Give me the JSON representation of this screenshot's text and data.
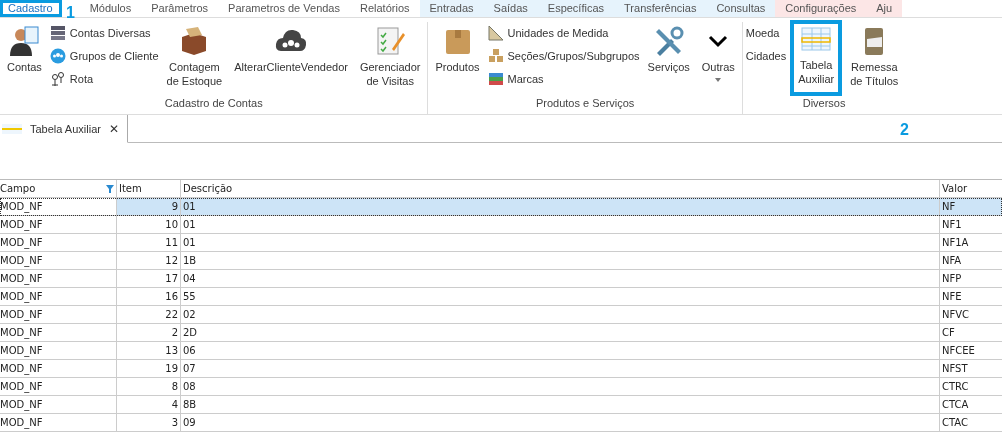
{
  "menu": [
    {
      "label": "Cadastro",
      "selected": true
    },
    {
      "label": "Módulos",
      "selected": false
    },
    {
      "label": "Parâmetros",
      "selected": false
    },
    {
      "label": "Parametros de Vendas",
      "selected": false
    },
    {
      "label": "Relatórios",
      "selected": false
    },
    {
      "label": "Entradas",
      "selected": false,
      "color": "#e6f3fc"
    },
    {
      "label": "Saídas",
      "selected": false,
      "color": "#e6f3fc"
    },
    {
      "label": "Específicas",
      "selected": false,
      "color": "#e6f3fc"
    },
    {
      "label": "Transferências",
      "selected": false,
      "color": "#e6f3fc"
    },
    {
      "label": "Consultas",
      "selected": false,
      "color": "#e6f3fc"
    },
    {
      "label": "Configurações",
      "selected": false,
      "color": "#fce6e6"
    },
    {
      "label": "Aju",
      "selected": false,
      "color": "#fce6e6"
    }
  ],
  "ribbon": [
    {
      "label": "Cadastro de Contas",
      "items": [
        {
          "kind": "large",
          "lines": [
            "Contas"
          ]
        },
        {
          "kind": "small",
          "entries": [
            "Contas Diversas",
            "Grupos de Cliente",
            "Rota"
          ]
        },
        {
          "kind": "large",
          "lines": [
            "Contagem",
            "de Estoque"
          ]
        },
        {
          "kind": "large",
          "lines": [
            "AlterarClienteVendedor"
          ]
        },
        {
          "kind": "large",
          "lines": [
            "Gerenciador",
            "de Visitas"
          ]
        }
      ]
    },
    {
      "label": "Produtos e Serviços",
      "items": [
        {
          "kind": "large",
          "lines": [
            "Produtos"
          ]
        },
        {
          "kind": "small",
          "entries": [
            "Unidades de Medida",
            "Seções/Grupos/Subgrupos",
            "Marcas"
          ]
        },
        {
          "kind": "large",
          "lines": [
            "Serviços"
          ]
        },
        {
          "kind": "large",
          "lines": [
            "Outras"
          ],
          "dropdown": true
        }
      ]
    },
    {
      "label": "Diversos",
      "items": [
        {
          "kind": "small",
          "entries": [
            "Moeda",
            "Cidades"
          ]
        },
        {
          "kind": "large",
          "lines": [
            "Tabela",
            "Auxiliar"
          ],
          "highlighted": true
        },
        {
          "kind": "large",
          "lines": [
            "Remessa",
            "de Títulos"
          ]
        }
      ]
    }
  ],
  "annotations": [
    "1",
    "2"
  ],
  "doc_tab": {
    "label": "Tabela Auxiliar",
    "close": "✕"
  },
  "table": {
    "columns": [
      "Campo",
      "Item",
      "Descrição",
      "Valor"
    ],
    "rows": [
      {
        "campo": "MOD_NF",
        "item": "9",
        "descricao": "01",
        "valor": "NF",
        "selected": true
      },
      {
        "campo": "MOD_NF",
        "item": "10",
        "descricao": "01",
        "valor": "NF1",
        "selected": false
      },
      {
        "campo": "MOD_NF",
        "item": "11",
        "descricao": "01",
        "valor": "NF1A",
        "selected": false
      },
      {
        "campo": "MOD_NF",
        "item": "12",
        "descricao": "1B",
        "valor": "NFA",
        "selected": false
      },
      {
        "campo": "MOD_NF",
        "item": "17",
        "descricao": "04",
        "valor": "NFP",
        "selected": false
      },
      {
        "campo": "MOD_NF",
        "item": "16",
        "descricao": "55",
        "valor": "NFE",
        "selected": false
      },
      {
        "campo": "MOD_NF",
        "item": "22",
        "descricao": "02",
        "valor": "NFVC",
        "selected": false
      },
      {
        "campo": "MOD_NF",
        "item": "2",
        "descricao": "2D",
        "valor": "CF",
        "selected": false
      },
      {
        "campo": "MOD_NF",
        "item": "13",
        "descricao": "06",
        "valor": "NFCEE",
        "selected": false
      },
      {
        "campo": "MOD_NF",
        "item": "19",
        "descricao": "07",
        "valor": "NFST",
        "selected": false
      },
      {
        "campo": "MOD_NF",
        "item": "8",
        "descricao": "08",
        "valor": "CTRC",
        "selected": false
      },
      {
        "campo": "MOD_NF",
        "item": "4",
        "descricao": "8B",
        "valor": "CTCA",
        "selected": false
      },
      {
        "campo": "MOD_NF",
        "item": "3",
        "descricao": "09",
        "valor": "CTAC",
        "selected": false
      }
    ]
  }
}
